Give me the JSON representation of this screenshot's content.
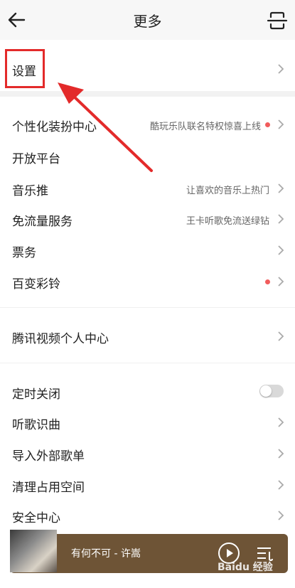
{
  "header": {
    "title": "更多",
    "back_icon": "arrow-left-icon",
    "scan_icon": "scan-icon"
  },
  "sections": {
    "settings": {
      "label": "设置"
    },
    "group1": [
      {
        "label": "个性化装扮中心",
        "sub": "酷玩乐队联名特权惊喜上线",
        "dot": true
      },
      {
        "label": "开放平台",
        "sub": "",
        "dot": false
      },
      {
        "label": "音乐推",
        "sub": "让喜欢的音乐上热门",
        "dot": false
      },
      {
        "label": "免流量服务",
        "sub": "王卡听歌免流送绿钻",
        "dot": false
      },
      {
        "label": "票务",
        "sub": "",
        "dot": false
      },
      {
        "label": "百变彩铃",
        "sub": "",
        "dot": true
      }
    ],
    "tencent_video": {
      "label": "腾讯视频个人中心"
    },
    "group3": [
      {
        "label": "定时关闭",
        "toggle": false
      },
      {
        "label": "听歌识曲"
      },
      {
        "label": "导入外部歌单"
      },
      {
        "label": "清理占用空间"
      },
      {
        "label": "安全中心"
      }
    ]
  },
  "player": {
    "song": "有何不可 - 许嵩"
  },
  "watermark": "Baidu 经验",
  "colors": {
    "accent_red": "#e32a2a",
    "dot_red": "#f15c5c",
    "player_bg": "#6e5436"
  }
}
